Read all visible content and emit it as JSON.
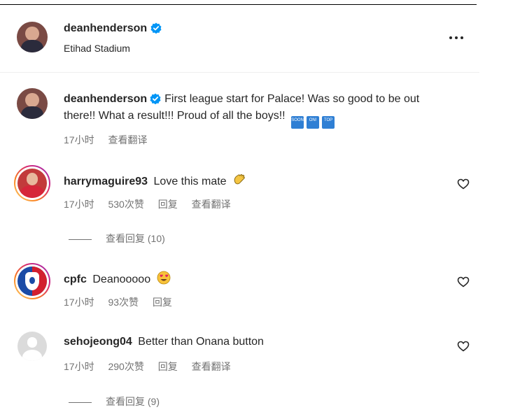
{
  "post": {
    "author": "deanhenderson",
    "location": "Etihad Stadium",
    "more_icon": "more-horizontal-icon"
  },
  "caption": {
    "author": "deanhenderson",
    "text": "First league start for Palace! Was so good to be out there!! What a result!!! Proud of all the boys!!",
    "emojis": [
      "SOON",
      "ON!",
      "TOP"
    ],
    "time": "17小时",
    "translate": "查看翻译"
  },
  "comments": [
    {
      "username": "harrymaguire93",
      "text": "Love this mate",
      "emoji": "clap-hands-emoji",
      "time": "17小时",
      "likes": "530次赞",
      "reply": "回复",
      "translate": "查看翻译",
      "view_replies": "查看回复 (10)"
    },
    {
      "username": "cpfc",
      "text": "Deanooooo",
      "emoji": "heart-eyes-emoji",
      "time": "17小时",
      "likes": "93次赞",
      "reply": "回复"
    },
    {
      "username": "sehojeong04",
      "text": "Better than Onana button",
      "time": "17小时",
      "likes": "290次赞",
      "reply": "回复",
      "translate": "查看翻译",
      "view_replies": "查看回复 (9)"
    }
  ],
  "colors": {
    "verified": "#0095f6",
    "secondary_text": "#737373",
    "primary_text": "#262626"
  }
}
